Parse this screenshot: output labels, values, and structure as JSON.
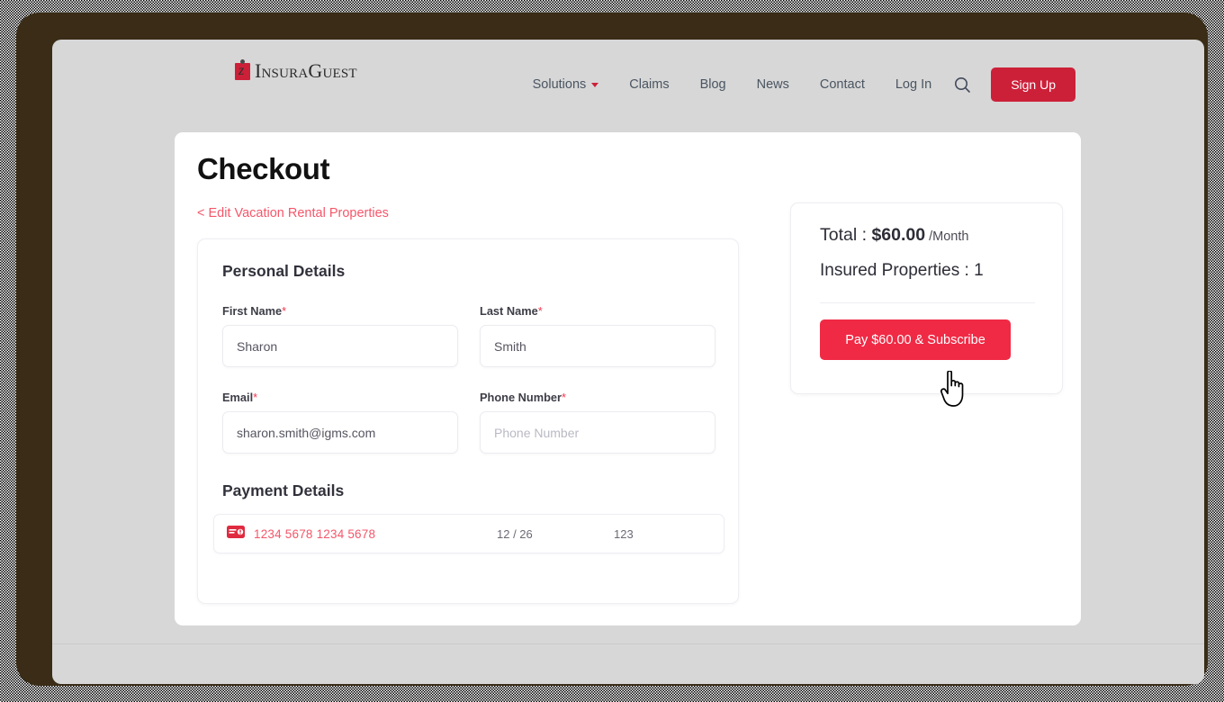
{
  "header": {
    "logo": {
      "icon": "insuraguest-logo-mark",
      "text": "InsuraGuest"
    },
    "nav_items": [
      {
        "label": "Solutions",
        "has_dropdown": true
      },
      {
        "label": "Claims",
        "has_dropdown": false
      },
      {
        "label": "Blog",
        "has_dropdown": false
      },
      {
        "label": "News",
        "has_dropdown": false
      },
      {
        "label": "Contact",
        "has_dropdown": false
      },
      {
        "label": "Log In",
        "has_dropdown": false
      }
    ],
    "search_icon": "search-icon",
    "signup_label": "Sign Up"
  },
  "page": {
    "title": "Checkout",
    "back_link": "< Edit Vacation Rental Properties"
  },
  "form": {
    "personal_details_title": "Personal Details",
    "payment_details_title": "Payment Details",
    "fields": {
      "first_name": {
        "label": "First Name",
        "required": "*",
        "value": "Sharon",
        "placeholder": "First Name"
      },
      "last_name": {
        "label": "Last Name",
        "required": "*",
        "value": "Smith",
        "placeholder": "Last Name"
      },
      "email": {
        "label": "Email",
        "required": "*",
        "value": "sharon.smith@igms.com",
        "placeholder": "Email"
      },
      "phone": {
        "label": "Phone Number",
        "required": "*",
        "value": "",
        "placeholder": "Phone Number"
      }
    },
    "payment": {
      "card_icon": "credit-card-icon",
      "card_number": "1234 5678 1234 5678",
      "expiry": "12 / 26",
      "cvc": "123"
    }
  },
  "summary": {
    "total_prefix": "Total : ",
    "total_amount": "$60.00",
    "total_period": " /Month",
    "insured_properties": "Insured Properties : 1",
    "pay_button_label": "Pay $60.00 & Subscribe"
  },
  "colors": {
    "brand_red": "#cc2039",
    "accent_red": "#f02a45",
    "link_red": "#f4576a",
    "page_background": "#d7d7d7",
    "frame_brown": "#3a2c16"
  }
}
